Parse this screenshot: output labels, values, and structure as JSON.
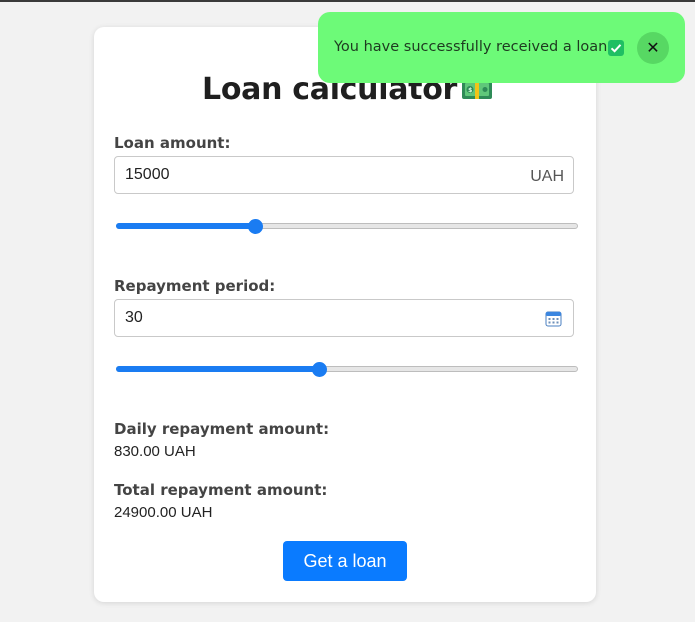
{
  "title": "Loan calculator",
  "title_icon": "money-bill-icon",
  "loan_amount": {
    "label": "Loan amount:",
    "value": "15000",
    "unit": "UAH",
    "slider_fraction": 0.3
  },
  "repayment_period": {
    "label": "Repayment period:",
    "value": "30",
    "icon": "calendar-icon",
    "slider_fraction": 0.44
  },
  "daily_repayment": {
    "label": "Daily repayment amount:",
    "value": "830.00 UAH"
  },
  "total_repayment": {
    "label": "Total repayment amount:",
    "value": "24900.00 UAH"
  },
  "button_label": "Get a loan",
  "toast": {
    "message": "You have successfully received a loan",
    "check_icon": "check-icon",
    "close_icon": "close-icon",
    "close_symbol": "✕"
  },
  "colors": {
    "accent": "#0a7bff",
    "toast_bg": "#6dfa78",
    "page_bg": "#f2f2f2"
  }
}
